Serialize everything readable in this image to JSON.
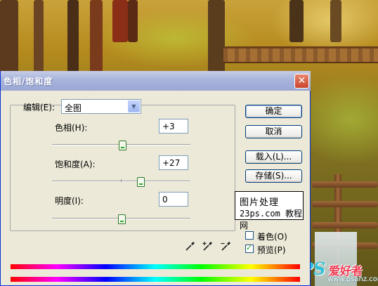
{
  "dialog": {
    "title": "色相/饱和度",
    "close_label": "✕"
  },
  "edit": {
    "label": "编辑(E):",
    "value": "全图"
  },
  "sliders": {
    "hue": {
      "label": "色相(H):",
      "value": "+3",
      "level": 0.51
    },
    "saturation": {
      "label": "饱和度(A):",
      "value": "+27",
      "level": 0.64
    },
    "lightness": {
      "label": "明度(I):",
      "value": "0",
      "level": 0.5
    }
  },
  "buttons": {
    "ok": "确定",
    "cancel": "取消",
    "load": "载入(L)...",
    "save": "存储(S)..."
  },
  "logo": {
    "line1": "图片处理",
    "line2": "23ps.com 教程网"
  },
  "options": {
    "colorize": {
      "label": "着色(O)",
      "checked": false
    },
    "preview": {
      "label": "预览(P)",
      "checked": true
    }
  },
  "icons": [
    "eyedropper-icon",
    "eyedropper-plus-icon",
    "eyedropper-minus-icon"
  ],
  "watermark": {
    "ps": "PS",
    "cn": "爱好者",
    "url": "www.psahz.com"
  },
  "colors": {
    "dialog_bg": "#ece9d8",
    "titlebar": "#9aa7d4",
    "close": "#c9442a",
    "thumb": "#2fa82f"
  }
}
